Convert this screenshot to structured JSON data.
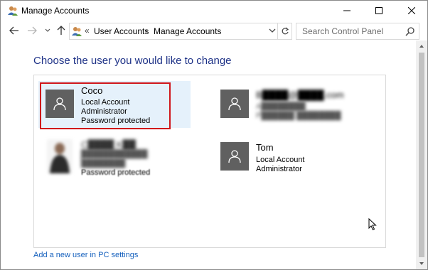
{
  "window": {
    "title": "Manage Accounts",
    "minimize_label": "–",
    "maximize_label": "□",
    "close_label": "✕"
  },
  "address_bar": {
    "prefix": "«",
    "crumbs": [
      "User Accounts",
      "Manage Accounts"
    ],
    "separator": "›"
  },
  "search": {
    "placeholder": "Search Control Panel"
  },
  "main": {
    "heading": "Choose the user you would like to change",
    "accounts": [
      {
        "name": "Coco",
        "lines": [
          "Local Account",
          "Administrator",
          "Password protected"
        ],
        "selected": true
      },
      {
        "name": "B████@████.com",
        "lines": [
          "A████████",
          "P██████ ████████"
        ],
        "blurred": true
      },
      {
        "name": "C████ K██",
        "lines": [
          "████████████",
          "████████",
          "Password protected"
        ],
        "blurred": true
      },
      {
        "name": "Tom",
        "lines": [
          "Local Account",
          "Administrator"
        ]
      }
    ],
    "add_user_link": "Add a new user in PC settings"
  },
  "colors": {
    "heading": "#1e3287",
    "link": "#1560bd",
    "selection_bg": "#e5f1fb",
    "selection_outline": "#d0161b",
    "avatar_bg": "#606060"
  }
}
